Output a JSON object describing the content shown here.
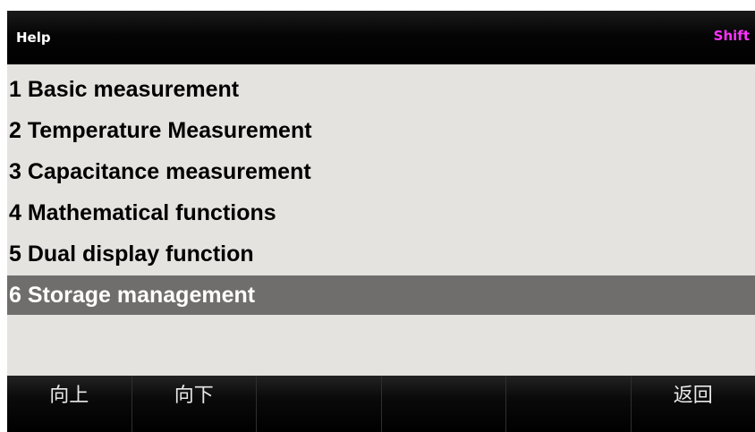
{
  "header": {
    "title": "Help",
    "shift_label": "Shift"
  },
  "colors": {
    "shift_indicator": "#ff33ff",
    "selected_row": "#6f6e6c",
    "menu_background": "#e5e3df"
  },
  "menu": {
    "selected_index": 5,
    "items": [
      {
        "label": "1 Basic measurement"
      },
      {
        "label": "2 Temperature Measurement"
      },
      {
        "label": "3 Capacitance measurement"
      },
      {
        "label": "4 Mathematical functions"
      },
      {
        "label": "5 Dual display function"
      },
      {
        "label": "6 Storage management"
      }
    ]
  },
  "softkeys": [
    {
      "label": "向上"
    },
    {
      "label": "向下"
    },
    {
      "label": ""
    },
    {
      "label": ""
    },
    {
      "label": ""
    },
    {
      "label": "返回"
    }
  ]
}
